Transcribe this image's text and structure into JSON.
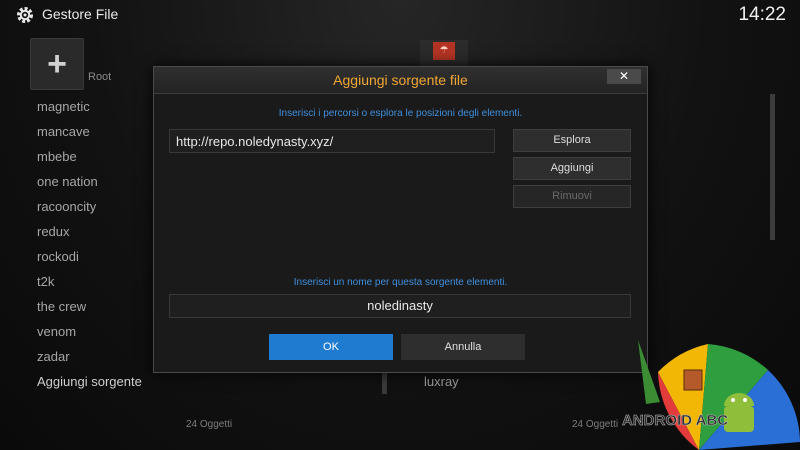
{
  "header": {
    "title": "Gestore File",
    "clock": "14:22",
    "icon": "gear-icon"
  },
  "left_pane": {
    "add_tile_icon": "plus-icon",
    "root_label": "Root",
    "items": [
      {
        "label": "magnetic"
      },
      {
        "label": "mancave"
      },
      {
        "label": "mbebe"
      },
      {
        "label": "one nation"
      },
      {
        "label": "racooncity"
      },
      {
        "label": "redux"
      },
      {
        "label": "rockodi"
      },
      {
        "label": "t2k"
      },
      {
        "label": "the crew"
      },
      {
        "label": "venom"
      },
      {
        "label": "zadar"
      },
      {
        "label": "Aggiungi sorgente"
      }
    ],
    "count": "24 Oggetti"
  },
  "right_pane": {
    "item": "luxray",
    "count": "24 Oggetti"
  },
  "dialog": {
    "title": "Aggiungi sorgente file",
    "close_label": "✕",
    "paths_hint": "Inserisci i percorsi o esplora le posizioni degli elementi.",
    "path_value": "http://repo.noledynasty.xyz/",
    "browse_label": "Esplora",
    "add_label": "Aggiungi",
    "remove_label": "Rimuovi",
    "name_hint": "Inserisci un nome per questa sorgente elementi.",
    "name_value": "noledinasty",
    "ok_label": "OK",
    "cancel_label": "Annulla"
  },
  "watermark": {
    "text": "ANDROID ABC",
    "icon": "android-robot-logo"
  },
  "colors": {
    "accent_title": "#f0a732",
    "hint": "#3f8fdc",
    "ok_button": "#1e7bd0"
  }
}
